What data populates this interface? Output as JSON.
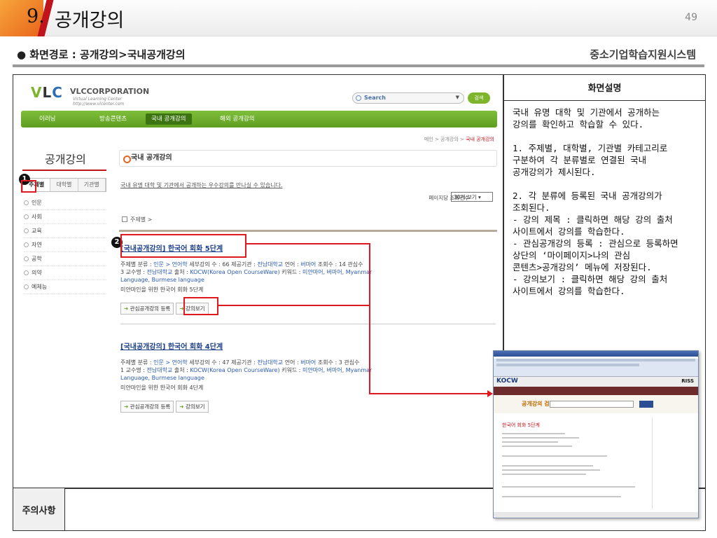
{
  "slide": {
    "num": "9.",
    "title": "공개강의",
    "page_num": "49",
    "path": "● 화면경로 : 공개강의>국내공개강의",
    "system": "중소기업학습지원시스템"
  },
  "desc": {
    "header": "화면설명",
    "body": "국내 유명 대학 및 기관에서 공개하는\n 강의를 확인하고 학습할 수 있다.\n\n1. 주제별, 대학별, 기관별 카테고리로\n 구분하여 각 분류별로 연결된 국내\n 공개강의가 제시된다.\n\n2. 각 분류에 등록된 국내 공개강의가\n 조회된다.\n - 강의 제목 : 클릭하면 해당 강의 출처\n 사이트에서 강의를 학습한다.\n - 관심공개강의 등록 : 관심으로 등록하면\n 상단의 ‘마이페이지>나의 관심\n 콘텐츠>공개강의’ 메뉴에 저장된다.\n - 강의보기 : 클릭하면 해당 강의 출처\n 사이트에서 강의를 학습한다."
  },
  "note": {
    "header": "주의사항"
  },
  "site": {
    "logo_v": "V",
    "logo_l": "L",
    "logo_c": "C",
    "corp": "VLCCORPORATION",
    "corp_sub1": "Virtual Learning Center",
    "corp_sub2": "http://www.vlcenter.com",
    "search_label": "Search",
    "search_btn": "검색",
    "nav": [
      "이러닝",
      "방송콘텐츠",
      "국내 공개강의",
      "해외 공개강의"
    ],
    "crumb": "메인 > 공개강의 > ",
    "crumb_current": "국내 공개강의",
    "side_title": "공개강의",
    "side_tabs": [
      "주제별",
      "대학별",
      "기관별"
    ],
    "side_items": [
      "인문",
      "사회",
      "교육",
      "자연",
      "공학",
      "의약",
      "예체능"
    ],
    "main_title": "국내 공개강의",
    "intro": "국내 유명 대학 및 기관에서 공개하는 우수강의를 만나실 수 있습니다.",
    "per_label": "페이지당 조회건수",
    "per_value": "30개 보기",
    "filter": "주제별 >",
    "courses": [
      {
        "title": "[국내공개강의] 한국어 회화 5단계",
        "meta_prefix": "주제별 분류 : ",
        "category": "인문 > 언어학",
        "meta_rest": "   세부강의 수 : 66   제공기관 : ",
        "provider": "전남대학교",
        "lang_label": "   언어 : ",
        "lang": "버마어",
        "views": "   조회수 : 14   관심수",
        "line2_num": "3",
        "prof_label": "   교수명 : ",
        "prof": "전남대학교",
        "source_label": "   출처 : ",
        "source": "KOCW(Korea Open CourseWare)",
        "kw_label": "   키워드 : ",
        "kw": "미얀마어, 버마어, Myanmar",
        "kw2": "Language, Burmese language",
        "desc": "미얀마인을 위한 한국어 회화 5단계",
        "btn_fav": "관심공개강의 등록",
        "btn_view": "강의보기"
      },
      {
        "title": "[국내공개강의] 한국어 회화 4단계",
        "meta_prefix": "주제별 분류 : ",
        "category": "인문 > 언어학",
        "meta_rest": "   세부강의 수 : 47   제공기관 : ",
        "provider": "전남대학교",
        "lang_label": "   언어 : ",
        "lang": "버마어",
        "views": "   조회수 : 3   관심수",
        "line2_num": "1",
        "prof_label": "   교수명 : ",
        "prof": "전남대학교",
        "source_label": "   출처 : ",
        "source": "KOCW(Korea Open CourseWare)",
        "kw_label": "   키워드 : ",
        "kw": "미얀마어, 버마어, Myanmar",
        "kw2": "Language, Burmese language",
        "desc": "미얀마인을 위한 한국어 회화 4단계",
        "btn_fav": "관심공개강의 등록",
        "btn_view": "강의보기"
      }
    ]
  },
  "inset": {
    "logo": "KOCW",
    "riss": "RISS",
    "search_title": "공개강의 검색",
    "course_title": "한국어 회화 5단계"
  },
  "markers": [
    "1",
    "2"
  ],
  "colors": {
    "accent": "#e8641b",
    "highlight": "#e0191e",
    "nav_green": "#6fae2c",
    "link": "#1c3f8b"
  }
}
